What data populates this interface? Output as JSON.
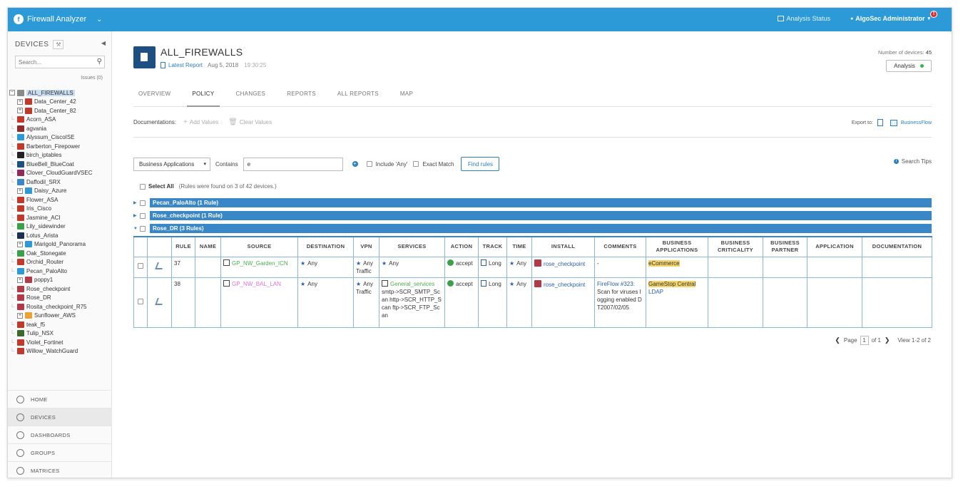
{
  "topbar": {
    "app_title": "Firewall Analyzer",
    "analysis_status": "Analysis Status",
    "user": "AlgoSec Administrator",
    "notification_count": "!"
  },
  "sidebar": {
    "title": "DEVICES",
    "search_placeholder": "Search...",
    "issues": "Issues (0)",
    "tree": [
      {
        "label": "ALL_FIREWALLS",
        "level": 0,
        "expander": "⊖",
        "color": "#8a8a8a",
        "selected": true
      },
      {
        "label": "Data_Center_42",
        "level": 1,
        "expander": "+",
        "color": "#c0392b"
      },
      {
        "label": "Data_Center_82",
        "level": 1,
        "expander": "+",
        "color": "#c0392b"
      },
      {
        "label": "Acorn_ASA",
        "level": 1,
        "color": "#c0392b"
      },
      {
        "label": "agvania",
        "level": 1,
        "color": "#8e2b2b"
      },
      {
        "label": "Alyssum_CiscoISE",
        "level": 1,
        "color": "#2b9ad7"
      },
      {
        "label": "Barberton_Firepower",
        "level": 1,
        "color": "#c0392b"
      },
      {
        "label": "birch_iptables",
        "level": 1,
        "color": "#222222"
      },
      {
        "label": "BlueBell_BlueCoat",
        "level": 1,
        "color": "#1c4f82"
      },
      {
        "label": "Clover_CloudGuardVSEC",
        "level": 1,
        "color": "#8e2b5a"
      },
      {
        "label": "Daffodil_SRX",
        "level": 1,
        "color": "#3a87c8"
      },
      {
        "label": "Daisy_Azure",
        "level": 1,
        "expander": "+",
        "color": "#2b9ad7"
      },
      {
        "label": "Flower_ASA",
        "level": 1,
        "color": "#c0392b"
      },
      {
        "label": "Iris_Cisco",
        "level": 1,
        "color": "#c0392b"
      },
      {
        "label": "Jasmine_ACI",
        "level": 1,
        "color": "#c0392b"
      },
      {
        "label": "Lily_sidewinder",
        "level": 1,
        "color": "#3aa04a"
      },
      {
        "label": "Lotus_Arista",
        "level": 1,
        "color": "#1c2f52"
      },
      {
        "label": "Marigold_Panorama",
        "level": 1,
        "expander": "+",
        "color": "#2b9ad7"
      },
      {
        "label": "Oak_Stonegate",
        "level": 1,
        "color": "#3aa04a"
      },
      {
        "label": "Orchid_Router",
        "level": 1,
        "color": "#c0392b"
      },
      {
        "label": "Pecan_PaloAlto",
        "level": 1,
        "color": "#2b9ad7"
      },
      {
        "label": "poppy1",
        "level": 1,
        "expander": "+",
        "color": "#b23a48"
      },
      {
        "label": "Rose_checkpoint",
        "level": 1,
        "color": "#b23a48"
      },
      {
        "label": "Rose_DR",
        "level": 1,
        "color": "#b23a48"
      },
      {
        "label": "Rosita_checkpoint_R75",
        "level": 1,
        "color": "#b23a48"
      },
      {
        "label": "Sunflower_AWS",
        "level": 1,
        "expander": "+",
        "color": "#f0a030"
      },
      {
        "label": "teak_f5",
        "level": 1,
        "color": "#c0392b"
      },
      {
        "label": "Tulip_NSX",
        "level": 1,
        "color": "#3a6a2a"
      },
      {
        "label": "Violet_Fortinet",
        "level": 1,
        "color": "#c0392b"
      },
      {
        "label": "Willow_WatchGuard",
        "level": 1,
        "color": "#c0392b"
      }
    ],
    "nav": [
      {
        "label": "HOME",
        "icon": "home-icon",
        "active": false
      },
      {
        "label": "DEVICES",
        "icon": "devices-icon",
        "active": true
      },
      {
        "label": "DASHBOARDS",
        "icon": "dashboard-icon",
        "active": false
      },
      {
        "label": "GROUPS",
        "icon": "groups-icon",
        "active": false
      },
      {
        "label": "MATRICES",
        "icon": "matrices-icon",
        "active": false
      }
    ]
  },
  "header": {
    "title": "ALL_FIREWALLS",
    "latest_report": "Latest Report",
    "report_date": "Aug 5, 2018",
    "report_time": "19:30:25",
    "device_count_label": "Number of devices:",
    "device_count": "45",
    "analysis_button": "Analysis"
  },
  "tabs": [
    {
      "label": "OVERVIEW",
      "active": false
    },
    {
      "label": "POLICY",
      "active": true
    },
    {
      "label": "CHANGES",
      "active": false
    },
    {
      "label": "REPORTS",
      "active": false
    },
    {
      "label": "ALL REPORTS",
      "active": false
    },
    {
      "label": "MAP",
      "active": false
    }
  ],
  "documentation": {
    "label": "Documentations:",
    "add_values": "Add Values",
    "clear_values": "Clear Values",
    "export_to": "Export to:",
    "businessflow": "BusinessFlow"
  },
  "filter": {
    "field": "Business Applications",
    "contains_label": "Contains",
    "value": "e",
    "include_any": "Include 'Any'",
    "exact_match": "Exact Match",
    "find_button": "Find rules",
    "search_tips": "Search Tips"
  },
  "results": {
    "select_all": "Select All",
    "note": "(Rules were found on 3 of 42 devices.)"
  },
  "groups": [
    {
      "label": "Pecan_PaloAlto (1 Rule)",
      "expanded": false
    },
    {
      "label": "Rose_checkpoint (1 Rule)",
      "expanded": false
    },
    {
      "label": "Rose_DR (3 Rules)",
      "expanded": true
    }
  ],
  "table": {
    "headers": [
      "",
      "",
      "RULE",
      "NAME",
      "SOURCE",
      "DESTINATION",
      "VPN",
      "SERVICES",
      "ACTION",
      "TRACK",
      "TIME",
      "INSTALL",
      "COMMENTS",
      "BUSINESS APPLICATIONS",
      "BUSINESS CRITICALITY",
      "BUSINESS PARTNER",
      "APPLICATION",
      "DOCUMENTATION"
    ],
    "rows": [
      {
        "rule": "37",
        "name": "",
        "source": "GP_NW_Garden_ICN",
        "destination": "Any",
        "vpn": "Any Traffic",
        "services_name": "",
        "services": "Any",
        "action": "accept",
        "track": "Long",
        "time": "Any",
        "install": "rose_checkpoint",
        "comments_link": "",
        "comments": "-",
        "business_apps": "eCommerce",
        "business_apps_extra": "",
        "business_criticality": "",
        "business_partner": "",
        "application": "",
        "documentation": ""
      },
      {
        "rule": "38",
        "name": "",
        "source": "GP_NW_BAL_LAN",
        "destination": "Any",
        "vpn": "Any Traffic",
        "services_name": "General_services",
        "services": "smtp->SCR_SMTP_Scan http->SCR_HTTP_Scan ftp->SCR_FTP_Scan",
        "action": "accept",
        "track": "Long",
        "time": "Any",
        "install": "rose_checkpoint",
        "comments_link": "FireFlow #323:",
        "comments": "Scan for viruses logging enabled DT2007/02/05",
        "business_apps": "GameStop Central",
        "business_apps_extra": "LDAP",
        "business_criticality": "",
        "business_partner": "",
        "application": "",
        "documentation": ""
      }
    ]
  },
  "pager": {
    "page_label": "Page",
    "page": "1",
    "of": "of 1",
    "view": "View 1-2 of 2"
  }
}
